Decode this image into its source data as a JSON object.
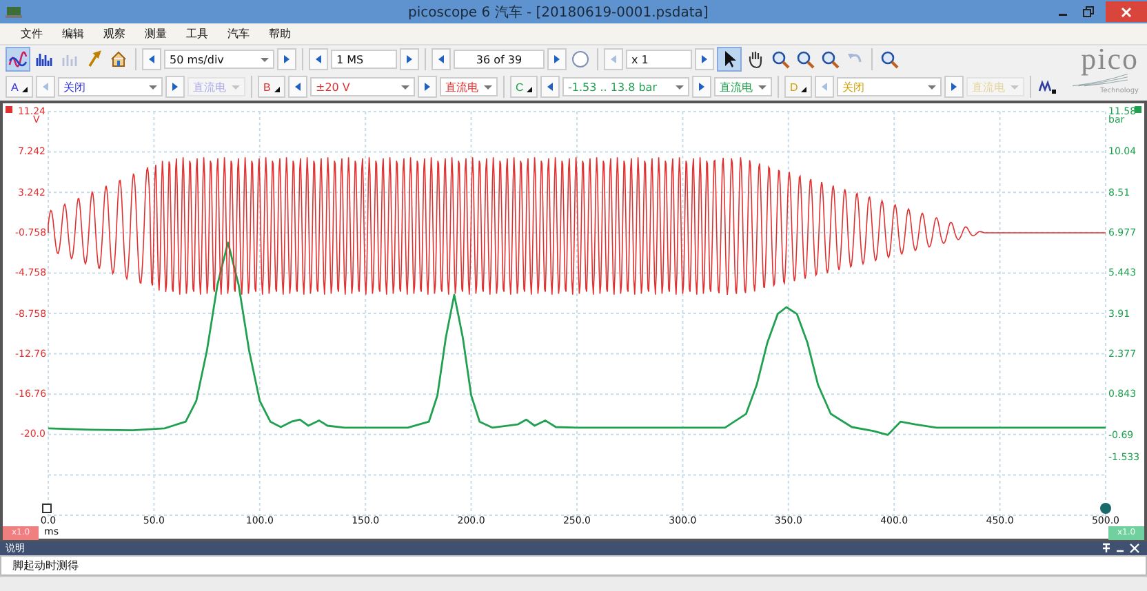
{
  "window": {
    "title": "picoscope 6 汽车 - [20180619-0001.psdata]"
  },
  "menu": [
    "文件",
    "编辑",
    "观察",
    "测量",
    "工具",
    "汽车",
    "帮助"
  ],
  "toolbar": {
    "timebase": "50 ms/div",
    "samples": "1 MS",
    "buffer": "36 of 39",
    "zoom": "x 1"
  },
  "channels": [
    {
      "label": "A",
      "range": "关闭",
      "coupling": "直流电",
      "color": "#3030e0",
      "enabled": false
    },
    {
      "label": "B",
      "range": "±20 V",
      "coupling": "直流电",
      "color": "#e03030",
      "enabled": true
    },
    {
      "label": "C",
      "range": "-1.53 .. 13.8 bar",
      "coupling": "直流电",
      "color": "#20a050",
      "enabled": true
    },
    {
      "label": "D",
      "range": "关闭",
      "coupling": "直流电",
      "color": "#d0a000",
      "enabled": false
    }
  ],
  "logo": {
    "name": "pico",
    "tagline": "Technology"
  },
  "plot": {
    "left_unit": "V",
    "right_unit": "bar",
    "x_unit": "ms",
    "left_scale": "x1.0",
    "right_scale": "x1.0",
    "left_ticks": [
      "11.24",
      "7.242",
      "3.242",
      "-0.758",
      "-4.758",
      "-8.758",
      "-12.76",
      "-16.76",
      "-20.0"
    ],
    "x_unit_shown": true
  },
  "chart_data": {
    "type": "line",
    "grid": true,
    "xlim": [
      0,
      500
    ],
    "ylim": [
      -3.75,
      11.58
    ],
    "yticks": [
      {
        "value": 11.58,
        "label": "11.58"
      },
      {
        "value": 10.04,
        "label": "10.04"
      },
      {
        "value": 8.51,
        "label": "8.51"
      },
      {
        "value": 6.977,
        "label": "6.977"
      },
      {
        "value": 5.443,
        "label": "5.443"
      },
      {
        "value": 3.91,
        "label": "3.91"
      },
      {
        "value": 2.377,
        "label": "2.377"
      },
      {
        "value": 0.843,
        "label": "0.843"
      },
      {
        "value": -0.69,
        "label": "-0.69"
      },
      {
        "value": -1.533,
        "label": "-1.533"
      }
    ],
    "xticks": [
      {
        "value": 0,
        "label": "0.0"
      },
      {
        "value": 50,
        "label": "50.0"
      },
      {
        "value": 100,
        "label": "100.0"
      },
      {
        "value": 150,
        "label": "150.0"
      },
      {
        "value": 200,
        "label": "200.0"
      },
      {
        "value": 250,
        "label": "250.0"
      },
      {
        "value": 300,
        "label": "300.0"
      },
      {
        "value": 350,
        "label": "350.0"
      },
      {
        "value": 400,
        "label": "400.0"
      },
      {
        "value": 450,
        "label": "450.0"
      },
      {
        "value": 500,
        "label": "500.0"
      }
    ],
    "x": [
      0,
      20,
      40,
      55,
      65,
      70,
      75,
      80,
      85,
      90,
      95,
      100,
      105,
      110,
      115,
      119,
      123,
      128,
      132,
      140,
      170,
      180,
      184,
      188,
      192,
      196,
      200,
      204,
      210,
      222,
      226,
      230,
      235,
      240,
      250,
      320,
      330,
      335,
      340,
      345,
      349,
      354,
      359,
      364,
      370,
      380,
      390,
      397,
      403,
      410,
      420,
      500
    ],
    "series": [
      {
        "color": "#20a050",
        "values": [
          -0.45,
          -0.5,
          -0.52,
          -0.45,
          -0.2,
          0.6,
          2.5,
          5.0,
          6.61,
          5.0,
          2.5,
          0.6,
          -0.2,
          -0.4,
          -0.2,
          -0.12,
          -0.35,
          -0.15,
          -0.35,
          -0.42,
          -0.42,
          -0.2,
          0.8,
          3.0,
          4.62,
          3.0,
          0.8,
          -0.2,
          -0.42,
          -0.3,
          -0.12,
          -0.35,
          -0.15,
          -0.4,
          -0.42,
          -0.42,
          0.1,
          1.2,
          2.8,
          3.9,
          4.15,
          3.9,
          2.8,
          1.2,
          0.1,
          -0.4,
          -0.55,
          -0.7,
          -0.2,
          -0.3,
          -0.42,
          -0.42
        ]
      }
    ]
  },
  "notes": {
    "title": "说明",
    "text": "脚起动时测得"
  }
}
